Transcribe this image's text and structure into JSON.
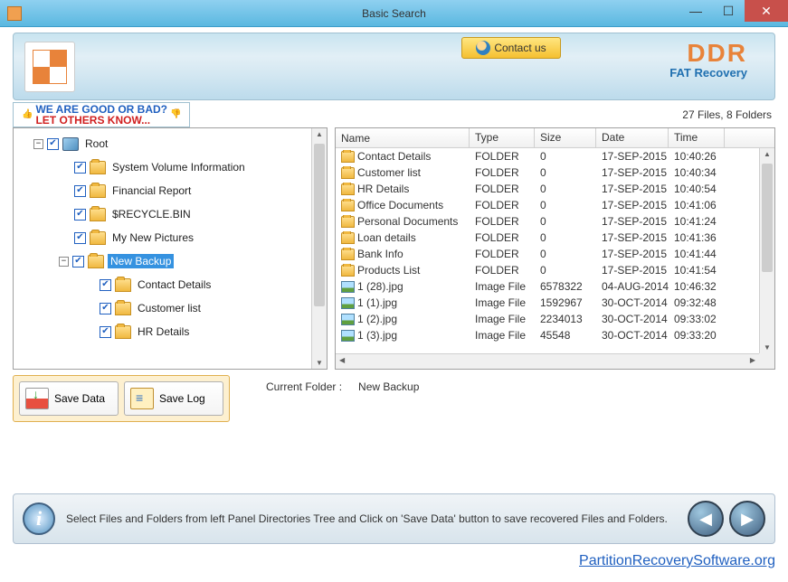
{
  "window": {
    "title": "Basic Search"
  },
  "header": {
    "contact_label": "Contact us",
    "brand": "DDR",
    "brand_sub": "FAT Recovery"
  },
  "feedback": {
    "line1": "WE ARE GOOD OR BAD?",
    "line2": "LET OTHERS KNOW..."
  },
  "stats": "27 Files, 8 Folders",
  "tree": {
    "root_label": "Root",
    "items": [
      {
        "label": "System Volume Information"
      },
      {
        "label": "Financial Report"
      },
      {
        "label": "$RECYCLE.BIN"
      },
      {
        "label": "My New Pictures"
      },
      {
        "label": "New Backup",
        "selected": true
      },
      {
        "label": "Contact Details"
      },
      {
        "label": "Customer list"
      },
      {
        "label": "HR Details"
      }
    ]
  },
  "list": {
    "headers": {
      "name": "Name",
      "type": "Type",
      "size": "Size",
      "date": "Date",
      "time": "Time"
    },
    "rows": [
      {
        "name": "Contact Details",
        "type": "FOLDER",
        "size": "0",
        "date": "17-SEP-2015",
        "time": "10:40:26",
        "icon": "folder"
      },
      {
        "name": "Customer list",
        "type": "FOLDER",
        "size": "0",
        "date": "17-SEP-2015",
        "time": "10:40:34",
        "icon": "folder"
      },
      {
        "name": "HR Details",
        "type": "FOLDER",
        "size": "0",
        "date": "17-SEP-2015",
        "time": "10:40:54",
        "icon": "folder"
      },
      {
        "name": "Office Documents",
        "type": "FOLDER",
        "size": "0",
        "date": "17-SEP-2015",
        "time": "10:41:06",
        "icon": "folder"
      },
      {
        "name": "Personal Documents",
        "type": "FOLDER",
        "size": "0",
        "date": "17-SEP-2015",
        "time": "10:41:24",
        "icon": "folder"
      },
      {
        "name": "Loan details",
        "type": "FOLDER",
        "size": "0",
        "date": "17-SEP-2015",
        "time": "10:41:36",
        "icon": "folder"
      },
      {
        "name": "Bank Info",
        "type": "FOLDER",
        "size": "0",
        "date": "17-SEP-2015",
        "time": "10:41:44",
        "icon": "folder"
      },
      {
        "name": "Products List",
        "type": "FOLDER",
        "size": "0",
        "date": "17-SEP-2015",
        "time": "10:41:54",
        "icon": "folder"
      },
      {
        "name": "1 (28).jpg",
        "type": "Image File",
        "size": "6578322",
        "date": "04-AUG-2014",
        "time": "10:46:32",
        "icon": "image"
      },
      {
        "name": "1 (1).jpg",
        "type": "Image File",
        "size": "1592967",
        "date": "30-OCT-2014",
        "time": "09:32:48",
        "icon": "image"
      },
      {
        "name": "1 (2).jpg",
        "type": "Image File",
        "size": "2234013",
        "date": "30-OCT-2014",
        "time": "09:33:02",
        "icon": "image"
      },
      {
        "name": "1 (3).jpg",
        "type": "Image File",
        "size": "45548",
        "date": "30-OCT-2014",
        "time": "09:33:20",
        "icon": "image"
      }
    ]
  },
  "actions": {
    "save_data": "Save Data",
    "save_log": "Save Log"
  },
  "current_folder": {
    "label": "Current Folder :",
    "value": "New Backup"
  },
  "bottom": {
    "info": "Select Files and Folders from left Panel Directories Tree and Click on 'Save Data' button to save recovered Files and Folders."
  },
  "footer": {
    "link": "PartitionRecoverySoftware.org"
  }
}
